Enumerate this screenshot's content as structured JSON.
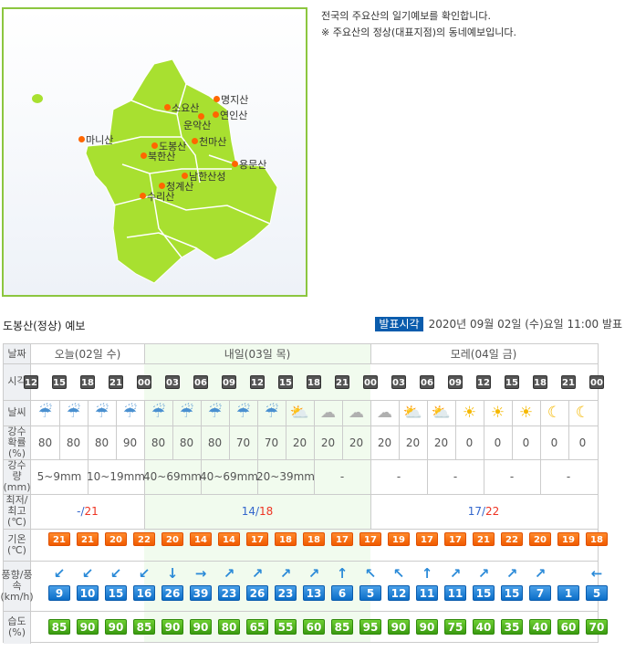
{
  "intro": {
    "line1": "전국의 주요산의 일기예보를 확인합니다.",
    "line2": "※ 주요산의 정상(대표지점)의 동네예보입니다."
  },
  "map": {
    "land_color": "#a8e030",
    "marker_color": "#ff6600",
    "peaks": [
      "명지산",
      "소요산",
      "연인산",
      "운악산",
      "마니산",
      "천마산",
      "도봉산",
      "북한산",
      "용문산",
      "남한산성",
      "청계산",
      "수리산"
    ]
  },
  "forecast": {
    "title": "도봉산(정상) 예보",
    "issue_tag": "발표시각",
    "issue_time": "2020년 09월 02일 (수)요일 11:00 발표",
    "labels": {
      "date": "날짜",
      "time": "시각",
      "weather": "날씨",
      "prob": "강수확률(%)",
      "amount": "강수량(mm)",
      "minmax": "최저/최고(℃)",
      "temp": "기온(℃)",
      "wind": "풍향/풍속(km/h)",
      "humidity": "습도(%)"
    },
    "days": [
      "오늘(02일 수)",
      "내일(03일 목)",
      "모레(04일 금)"
    ],
    "times": [
      "12",
      "15",
      "18",
      "21",
      "00",
      "03",
      "06",
      "09",
      "12",
      "15",
      "18",
      "21",
      "00",
      "03",
      "06",
      "09",
      "12",
      "15",
      "18",
      "21",
      "00"
    ],
    "weather": [
      "rain",
      "rain",
      "rain",
      "rain",
      "rain",
      "rain",
      "rain",
      "rain",
      "rain",
      "sun-cloud",
      "moon-cloud",
      "moon-cloud",
      "moon-cloud",
      "sun-cloud",
      "sun-cloud",
      "sun",
      "sun",
      "sun",
      "moon",
      "moon"
    ],
    "prob": [
      "80",
      "80",
      "80",
      "90",
      "80",
      "80",
      "80",
      "70",
      "70",
      "20",
      "20",
      "20",
      "20",
      "20",
      "20",
      "0",
      "0",
      "0",
      "0",
      "0"
    ],
    "amount": [
      "5~9mm",
      "10~19mm",
      "40~69mm",
      "40~69mm",
      "20~39mm",
      "-",
      "-",
      "-",
      "-",
      "-"
    ],
    "minmax": [
      {
        "min": "-",
        "max": "21"
      },
      {
        "min": "14",
        "max": "18"
      },
      {
        "min": "17",
        "max": "22"
      }
    ],
    "temp": [
      "21",
      "21",
      "20",
      "22",
      "20",
      "14",
      "14",
      "17",
      "18",
      "18",
      "17",
      "17",
      "19",
      "17",
      "17",
      "21",
      "22",
      "20",
      "19",
      "18"
    ],
    "wind_dir": [
      "sw",
      "sw",
      "sw",
      "sw",
      "s",
      "e",
      "ne",
      "ne",
      "ne",
      "ne",
      "n",
      "nw",
      "nw",
      "n",
      "ne",
      "ne",
      "ne",
      "ne",
      "",
      "w"
    ],
    "wind_speed": [
      "9",
      "10",
      "15",
      "16",
      "26",
      "39",
      "23",
      "26",
      "23",
      "13",
      "6",
      "5",
      "12",
      "11",
      "11",
      "15",
      "15",
      "7",
      "1",
      "5"
    ],
    "humidity": [
      "85",
      "90",
      "90",
      "85",
      "90",
      "90",
      "80",
      "65",
      "55",
      "60",
      "85",
      "95",
      "90",
      "90",
      "75",
      "40",
      "35",
      "40",
      "60",
      "70"
    ],
    "colors": {
      "min": "#3366cc",
      "max": "#ee3322",
      "tomorrow_bg": "#f1fbee"
    }
  }
}
